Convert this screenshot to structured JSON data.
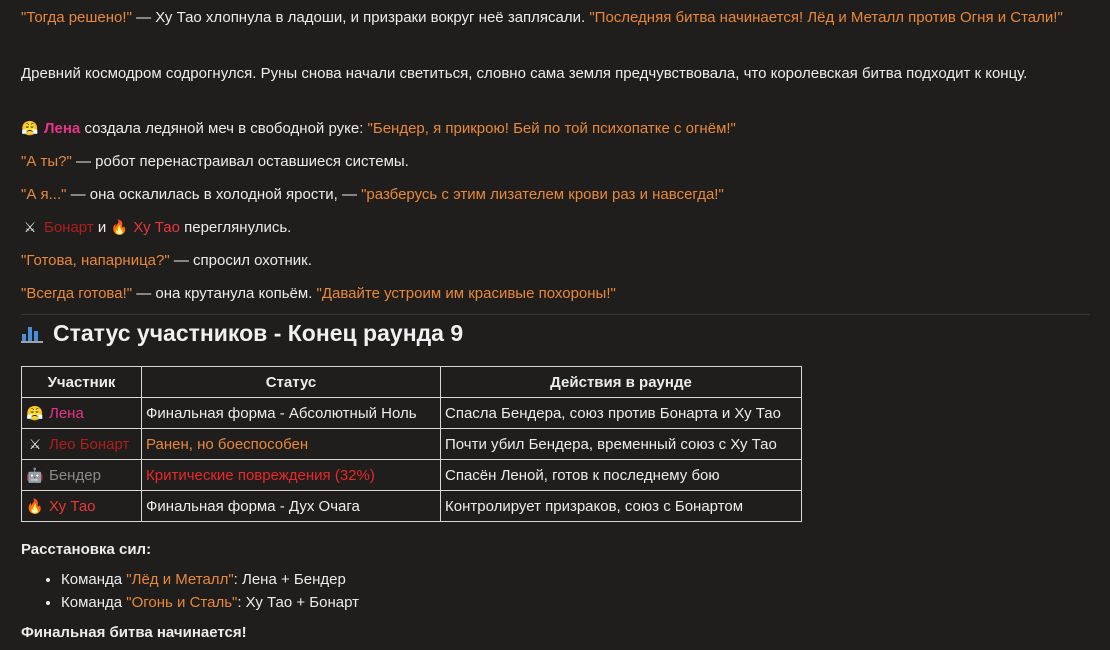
{
  "narration": {
    "p1_quote1": "\"Тогда решено!\"",
    "p1_text": " — Ху Тао хлопнула в ладоши, и призраки вокруг неё заплясали. ",
    "p1_quote2": "\"Последняя битва начинается! Лёд и Металл против Огня и Стали!\"",
    "p2_text": "Древний космодром содрогнулся. Руны снова начали светиться, словно сама земля предчувствовала, что королевская битва подходит к концу.",
    "l3_name": "Лена",
    "l3_text": " создала ледяной меч в свободной руке: ",
    "l3_quote": "\"Бендер, я прикрою! Бей по той психопатке с огнём!\"",
    "l4_quote": "\"А ты?\"",
    "l4_text": " — робот перенастраивал оставшиеся системы.",
    "l5_quote1": "\"А я...\"",
    "l5_text": " — она оскалилась в холодной ярости, — ",
    "l5_quote2": "\"разберусь с этим лизателем крови раз и навсегда!\"",
    "l6_name1": "Бонарт",
    "l6_and": " и ",
    "l6_name2": "Ху Тао",
    "l6_text": " переглянулись.",
    "l7_quote": "\"Готова, напарница?\"",
    "l7_text": " — спросил охотник.",
    "l8_quote1": "\"Всегда готова!\"",
    "l8_text": " — она крутанула копьём. ",
    "l8_quote2": "\"Давайте устроим им красивые похороны!\""
  },
  "status": {
    "title": "Статус участников - Конец раунда 9",
    "headers": [
      "Участник",
      "Статус",
      "Действия в раунде"
    ],
    "rows": [
      {
        "name": "Лена",
        "status": "Финальная форма - Абсолютный Ноль",
        "actions": "Спасла Бендера, союз против Бонарта и Ху Тао"
      },
      {
        "name": "Лео Бонарт",
        "status": "Ранен, но боеспособен",
        "actions": "Почти убил Бендера, временный союз с Ху Тао"
      },
      {
        "name": "Бендер",
        "status": "Критические повреждения (32%)",
        "actions": "Спасён Леной, готов к последнему бою"
      },
      {
        "name": "Ху Тао",
        "status": "Финальная форма - Дух Очага",
        "actions": "Контролирует призраков, союз с Бонартом"
      }
    ]
  },
  "forces": {
    "title": "Расстановка сил:",
    "team_word": "Команда ",
    "team1_name": "\"Лёд и Металл\"",
    "team1_members": ": Лена + Бендер",
    "team2_name": "\"Огонь и Сталь\"",
    "team2_members": ": Ху Тао + Бонарт"
  },
  "final_line": "Финальная битва начинается!",
  "colors": {
    "quote": "#e8883a",
    "lena": "#e8338a",
    "bonart": "#b01d1d",
    "hutao": "#e8383a",
    "bender": "#8a8a8a",
    "critical": "#e8282a"
  }
}
